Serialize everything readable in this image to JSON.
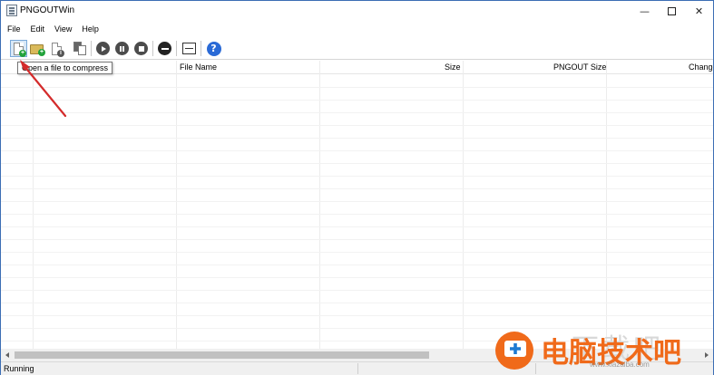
{
  "window": {
    "title": "PNGOUTWin",
    "controls": {
      "minimize": "—",
      "close": "✕"
    }
  },
  "menu": [
    "File",
    "Edit",
    "View",
    "Help"
  ],
  "toolbar": {
    "buttons": [
      {
        "name": "open-file",
        "icon": "file-add-icon"
      },
      {
        "name": "open-folder",
        "icon": "folder-add-icon"
      },
      {
        "name": "file-info",
        "icon": "file-info-icon"
      },
      {
        "name": "copy",
        "icon": "copy-icon"
      },
      {
        "name": "start",
        "icon": "play-icon"
      },
      {
        "name": "pause",
        "icon": "pause-icon"
      },
      {
        "name": "stop",
        "icon": "stop-icon"
      },
      {
        "name": "remove",
        "icon": "remove-icon"
      },
      {
        "name": "fit-columns",
        "icon": "fit-columns-icon"
      },
      {
        "name": "help",
        "icon": "help-icon",
        "glyph": "?"
      }
    ],
    "tooltip": "Open a file to compress"
  },
  "table": {
    "columns": [
      "",
      "File Name",
      "Size",
      "PNGOUT Size",
      "Change"
    ],
    "rows": []
  },
  "status": {
    "text": "Running"
  },
  "watermark": {
    "text": "电脑技术吧",
    "small": "www.xiazaiba.com",
    "ghost": "下载吧"
  },
  "colors": {
    "accent": "#3c6eb4",
    "arrow": "#d42b2b",
    "watermark": "#f06a1a",
    "help": "#2a6ad6"
  }
}
